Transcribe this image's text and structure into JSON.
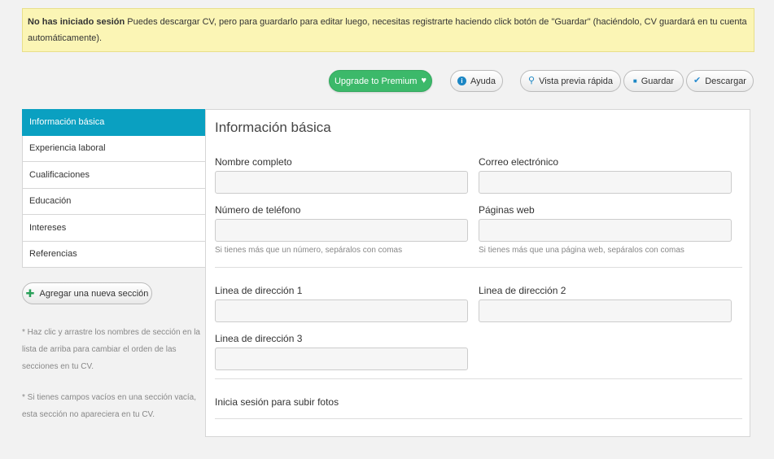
{
  "alert": {
    "bold": "No has iniciado sesión",
    "text": " Puedes descargar CV, pero para guardarlo para editar luego, necesitas registrarte haciendo click botón de \"Guardar\" (haciéndolo, CV guardará en tu cuenta automáticamente)."
  },
  "toolbar": {
    "premium": "Upgrade to Premium",
    "premium_icon": "♥",
    "help": "Ayuda",
    "preview": "Vista previa rápida",
    "save": "Guardar",
    "download": "Descargar"
  },
  "icons": {
    "info": "i",
    "search": "⚲",
    "save": "■",
    "check": "✔",
    "plus": "✚"
  },
  "sidebar": {
    "items": [
      {
        "label": "Información básica"
      },
      {
        "label": "Experiencia laboral"
      },
      {
        "label": "Cualificaciones"
      },
      {
        "label": "Educación"
      },
      {
        "label": "Intereses"
      },
      {
        "label": "Referencias"
      }
    ],
    "add_section": "Agregar una nueva sección",
    "hint1": "* Haz clic y arrastre los nombres de sección en la lista de arriba para cambiar el orden de las secciones en tu CV.",
    "hint2": "* Si tienes campos vacíos en una sección vacía, esta sección no apareciera en tu CV."
  },
  "form": {
    "title": "Información básica",
    "full_name_label": "Nombre completo",
    "email_label": "Correo electrónico",
    "phone_label": "Número de teléfono",
    "web_label": "Páginas web",
    "phone_help": "Si tienes más que un número, sepáralos con comas",
    "web_help": "Si tienes más que una página web, sepáralos con comas",
    "addr1_label": "Linea de dirección 1",
    "addr2_label": "Linea de dirección 2",
    "addr3_label": "Linea de dirección 3",
    "photo_text": "Inicia sesión para subir fotos"
  },
  "colors": {
    "accent": "#0aa0c1",
    "premium": "#3cb96a",
    "alert_bg": "#fbf5b5"
  }
}
